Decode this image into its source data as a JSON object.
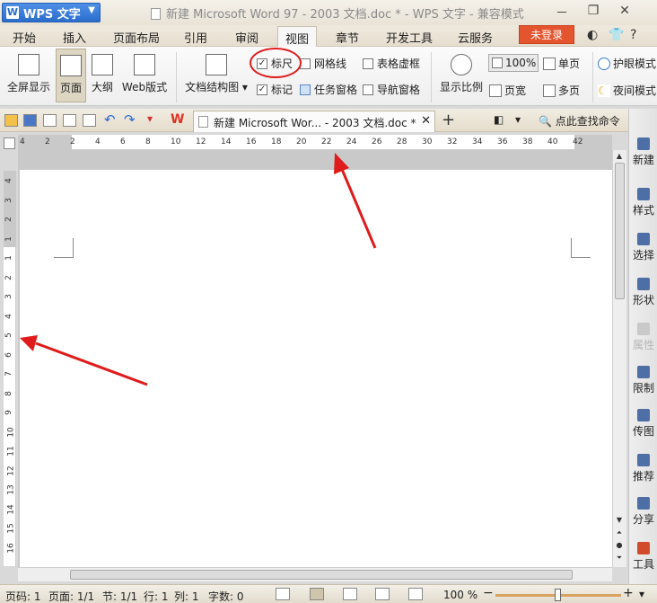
{
  "app": {
    "button_label": "WPS 文字",
    "window_title": "新建 Microsoft Word 97 - 2003 文档.doc * - WPS 文字 - 兼容模式"
  },
  "menu": {
    "tabs": [
      "开始",
      "插入",
      "页面布局",
      "引用",
      "审阅",
      "视图",
      "章节",
      "开发工具",
      "云服务"
    ],
    "active_tab": "视图",
    "login_label": "未登录"
  },
  "ribbon": {
    "view_buttons": [
      "全屏显示",
      "页面",
      "大纲",
      "Web版式"
    ],
    "doc_structure_label": "文档结构图",
    "checkboxes": [
      {
        "label": "标尺",
        "checked": true
      },
      {
        "label": "网格线",
        "checked": false
      },
      {
        "label": "表格虚框",
        "checked": false
      },
      {
        "label": "标记",
        "checked": true
      },
      {
        "label": "任务窗格",
        "checked": false
      },
      {
        "label": "导航窗格",
        "checked": false
      }
    ],
    "zoom_label": "显示比例",
    "zoom_value": "100%",
    "page_width_label": "页宽",
    "single_page_label": "单页",
    "multi_page_label": "多页",
    "eye_mode_label": "护眼模式",
    "night_mode_label": "夜间模式"
  },
  "document_tab": {
    "title": "新建 Microsoft Wor... - 2003 文档.doc *",
    "search_label": "点此查找命令"
  },
  "rulers": {
    "horizontal": [
      "4",
      "2",
      "2",
      "4",
      "6",
      "8",
      "10",
      "12",
      "14",
      "16",
      "18",
      "20",
      "22",
      "24",
      "26",
      "28",
      "30",
      "32",
      "34",
      "36",
      "38",
      "40",
      "42"
    ],
    "vertical": [
      "4",
      "3",
      "2",
      "1",
      "1",
      "2",
      "3",
      "4",
      "5",
      "6",
      "7",
      "8",
      "9",
      "10",
      "11",
      "12",
      "13",
      "14",
      "15",
      "16"
    ]
  },
  "task_pane": {
    "items": [
      "新建",
      "样式",
      "选择",
      "形状",
      "属性",
      "限制",
      "传图",
      "推荐",
      "分享",
      "工具"
    ],
    "disabled_item": "属性"
  },
  "status_bar": {
    "page_code": "页码: 1",
    "page_count": "页面: 1/1",
    "section": "节: 1/1",
    "row": "行: 1",
    "column": "列: 1",
    "word_count": "字数: 0",
    "zoom_percent": "100 %"
  },
  "colors": {
    "annotation": "#e01b1b",
    "app_button": "#2a6dcc",
    "login_button": "#e4542f"
  }
}
